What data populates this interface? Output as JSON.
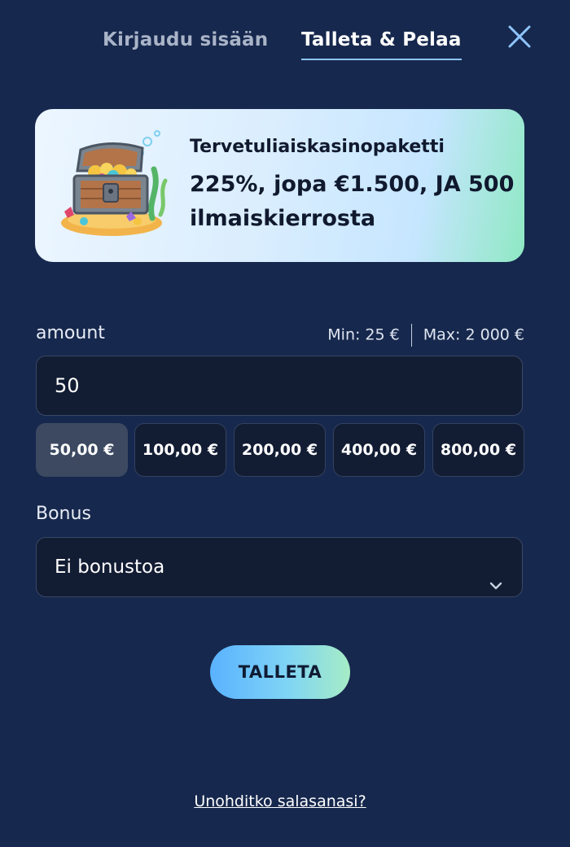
{
  "tabs": {
    "login": "Kirjaudu sisään",
    "deposit": "Talleta & Pelaa"
  },
  "icons": {
    "close": "close-icon",
    "chevron": "chevron-down-icon",
    "chest": "treasure-chest-icon"
  },
  "banner": {
    "title": "Tervetuliaiskasinopaketti",
    "offer": "225%, jopa €1.500, JA 500 ilmaiskierrosta"
  },
  "amount": {
    "label": "amount",
    "min": "Min: 25 €",
    "max": "Max: 2 000 €",
    "value": "50",
    "presets": [
      "50,00 €",
      "100,00 €",
      "200,00 €",
      "400,00 €",
      "800,00 €"
    ],
    "selected_preset": "50,00 €"
  },
  "bonus": {
    "label": "Bonus",
    "selected": "Ei bonustoa"
  },
  "actions": {
    "deposit": "TALLETA",
    "forgot_password": "Unohditko salasanasi?"
  },
  "colors": {
    "background": "#16284d",
    "field": "#121c33",
    "active_preset": "#3c4961",
    "accent_underline": "#8fc4ff",
    "button_start": "#5ab2ff",
    "button_end": "#a6ecc6"
  }
}
